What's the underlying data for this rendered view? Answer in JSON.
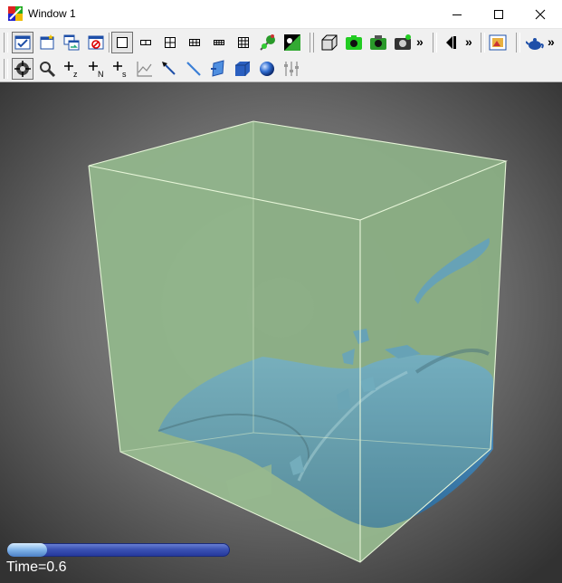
{
  "window": {
    "title": "Window 1"
  },
  "toolbar_row1": {
    "buttons": [
      "view-check-icon",
      "new-window-icon",
      "copy-window-icon",
      "close-view-icon",
      "single-layout-icon",
      "two-panel-layout-icon",
      "quad-layout-icon",
      "six-panel-layout-icon",
      "eight-panel-layout-icon",
      "nine-panel-layout-icon",
      "lock-icon",
      "invert-icon",
      "box-outline-icon",
      "save-image-icon",
      "camera-icon",
      "screenshot-icon",
      "play-reverse-icon",
      "frame-icon",
      "teapot-icon"
    ]
  },
  "toolbar_row2": {
    "buttons": [
      "navigate-icon",
      "zoom-icon",
      "add-z-icon",
      "add-n-icon",
      "add-s-icon",
      "plot-icon",
      "pick-icon",
      "line-icon",
      "plane-icon",
      "box-icon",
      "sphere-icon",
      "slider-icon"
    ]
  },
  "overlay": {
    "time_text": "Time=0.6",
    "progress": 0.18
  }
}
